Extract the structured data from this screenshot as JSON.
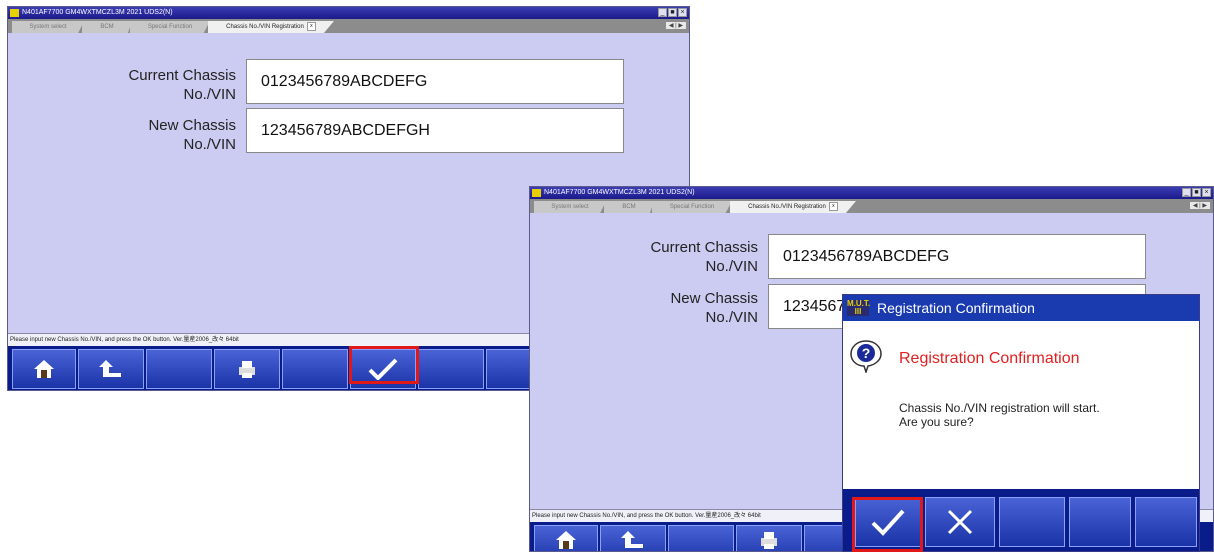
{
  "window1": {
    "title": "N401AF7700   GM4WXTMCZL3M 2021   UDS2(N)",
    "tabs": [
      "System select",
      "BCM",
      "Special Function",
      "Chassis No./VIN Registration"
    ],
    "current_label": "Current Chassis\nNo./VIN",
    "current_value": "0123456789ABCDEFG",
    "new_label": "New Chassis\nNo./VIN",
    "new_value": "123456789ABCDEFGH",
    "status": "Please input new Chassis No./VIN, and press the OK button.   Ver.量産2006_改々 64bit"
  },
  "window2": {
    "title": "N401AF7700   GM4WXTMCZL3M 2021   UDS2(N)",
    "tabs": [
      "System select",
      "BCM",
      "Special Function",
      "Chassis No./VIN Registration"
    ],
    "current_label": "Current Chassis\nNo./VIN",
    "current_value": "0123456789ABCDEFG",
    "new_label": "New Chassis\nNo./VIN",
    "new_value": "123456789ABCDEFGH",
    "status": "Please input new Chassis No./VIN, and press the OK button.   Ver.量産2006_改々 64bit"
  },
  "dialog": {
    "logo_text": "M.U.T.\nIII",
    "title": "Registration Confirmation",
    "heading": "Registration Confirmation",
    "message": "Chassis No./VIN registration will start.\nAre you sure?"
  },
  "icons": {
    "home": "home-icon",
    "back": "back-arrow-icon",
    "print": "printer-icon",
    "ok": "checkmark-icon",
    "cancel": "cancel-x-icon",
    "help": "question-icon"
  },
  "colors": {
    "window_bg": "#ccccf2",
    "titlebar": "#1a1a8a",
    "toolbar": "#0a1c8a",
    "highlight": "#e01818",
    "dialog_heading": "#e02020"
  }
}
